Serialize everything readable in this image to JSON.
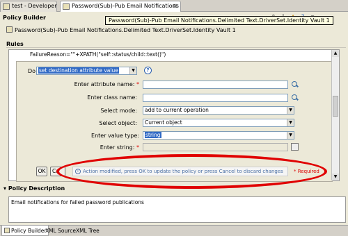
{
  "tabs": [
    {
      "label": "test - Developer"
    },
    {
      "label": "Password(Sub)-Pub Email Notifications",
      "close": "⊠"
    }
  ],
  "tooltip": "Password(Sub)-Pub Email Notifications.Delimited Text.DriverSet.Identity Vault 1",
  "policy_builder": {
    "title": "Policy Builder",
    "path": "Password(Sub)-Pub Email Notifications.Delimited Text.DriverSet.Identity Vault 1"
  },
  "rules": {
    "title": "Rules",
    "failure_line": "FailureReason=\"\"+XPATH(\"self::status/child::text()\")",
    "do_label": "Do",
    "do_value": "set destination attribute value",
    "fields": {
      "attribute_name": {
        "label": "Enter attribute name:",
        "required": "*",
        "value": ""
      },
      "class_name": {
        "label": "Enter class name:",
        "value": ""
      },
      "select_mode": {
        "label": "Select mode:",
        "value": "add to current operation"
      },
      "select_object": {
        "label": "Select object:",
        "value": "Current object"
      },
      "value_type": {
        "label": "Enter value type:",
        "value": "string"
      },
      "string": {
        "label": "Enter string:",
        "required": "*",
        "value": ""
      }
    },
    "ok_label": "OK",
    "cancel_label": "Ca",
    "message": "Action modified, press OK to update the policy or press Cancel to discard changes",
    "required_note": "* Required"
  },
  "policy_description": {
    "title": "Policy Description",
    "text": "Email notifications for failed password publications"
  },
  "bottom_tabs": [
    {
      "label": "Policy Builder"
    },
    {
      "label": "XML Source"
    },
    {
      "label": "XML Tree"
    }
  ],
  "colors": {
    "highlight": "#e00000",
    "selection": "#316ac5",
    "info_text": "#4a6fa5"
  }
}
